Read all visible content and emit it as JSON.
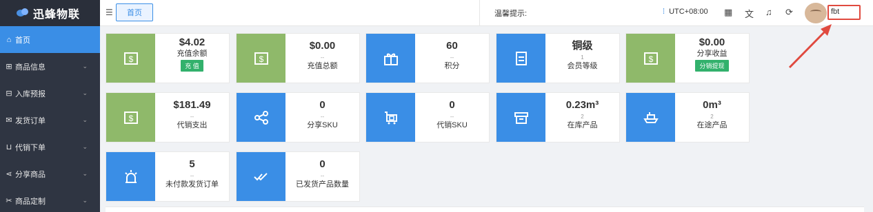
{
  "app": {
    "title": "迅蜂物联"
  },
  "sidebar": {
    "items": [
      {
        "label": "首页",
        "icon": "home-icon",
        "glyph": "⌂",
        "active": true,
        "expandable": false
      },
      {
        "label": "商品信息",
        "icon": "gift-icon",
        "glyph": "⊞",
        "active": false,
        "expandable": true
      },
      {
        "label": "入库预报",
        "icon": "truck-icon",
        "glyph": "⊟",
        "active": false,
        "expandable": true
      },
      {
        "label": "发货订单",
        "icon": "mail-icon",
        "glyph": "✉",
        "active": false,
        "expandable": true
      },
      {
        "label": "代销下单",
        "icon": "cart-icon",
        "glyph": "⊔",
        "active": false,
        "expandable": true
      },
      {
        "label": "分享商品",
        "icon": "share-icon",
        "glyph": "⋖",
        "active": false,
        "expandable": true
      },
      {
        "label": "商品定制",
        "icon": "customize-icon",
        "glyph": "✂",
        "active": false,
        "expandable": true
      }
    ]
  },
  "header": {
    "tab_home": "首页",
    "notice_label": "温馨提示:",
    "timezone": "UTC+08:00",
    "user_name": "fbt"
  },
  "cards": {
    "balance": {
      "value": "$4.02",
      "label": "充值余额",
      "button": "充 值"
    },
    "recharge_total": {
      "value": "$0.00",
      "sub": "--",
      "label": "充值总额"
    },
    "points": {
      "value": "60",
      "sub": "--",
      "label": "积分"
    },
    "level": {
      "value": "铜级",
      "sub": "1",
      "label": "会员等级"
    },
    "share_income": {
      "value": "$0.00",
      "label": "分享收益",
      "button": "分销提现"
    },
    "consign_spend": {
      "value": "$181.49",
      "sub": "--",
      "label": "代销支出"
    },
    "share_sku": {
      "value": "0",
      "sub": "--",
      "label": "分享SKU"
    },
    "consign_sku": {
      "value": "0",
      "sub": "--",
      "label": "代销SKU"
    },
    "in_stock": {
      "value": "0.23m³",
      "sub": "2",
      "label": "在库产品"
    },
    "in_transit": {
      "value": "0m³",
      "sub": "2",
      "label": "在途产品"
    },
    "unpaid_orders": {
      "value": "5",
      "sub": "--",
      "label": "未付款发货订单"
    },
    "shipped_qty": {
      "value": "0",
      "sub": "--",
      "label": "已发货产品数量"
    }
  },
  "colors": {
    "primary": "#3a8ee6",
    "green_tile": "#8fb96a",
    "button_green": "#32b16c",
    "sidebar": "#2f3542",
    "highlight": "#e04a3f"
  }
}
